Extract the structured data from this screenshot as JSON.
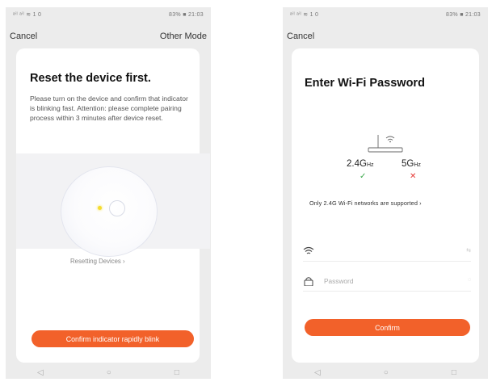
{
  "left": {
    "status_left": "ᵃⁱˡ ᵃⁱˡ ≋ 1 0",
    "status_right": "83% ■ 21:03",
    "nav_cancel": "Cancel",
    "nav_other_mode": "Other Mode",
    "title": "Reset the device first.",
    "description": "Please turn on the device and confirm that indicator is blinking fast. Attention: please complete pairing process within 3 minutes after device reset.",
    "resetting_link": "Resetting Devices",
    "resetting_chevron": "›",
    "confirm_button": "Confirm indicator rapidly blink"
  },
  "right": {
    "status_left": "ᵃⁱˡ ᵃⁱˡ ≋ 1 0",
    "status_right": "83% ■ 21:03",
    "nav_cancel": "Cancel",
    "title": "Enter Wi-Fi Password",
    "band_24": "2.4G",
    "band_24_unit": "Hz",
    "band_5": "5G",
    "band_5_unit": "Hz",
    "check_mark": "✓",
    "cross_mark": "✕",
    "note": "Only 2.4G Wi-Fi networks are supported",
    "note_chevron": "›",
    "ssid_value": "",
    "ssid_end": "⇆",
    "password_placeholder": "Password",
    "password_end": "◌",
    "confirm_button": "Confirm"
  },
  "bottom_nav": {
    "back": "◁",
    "home": "○",
    "recent": "□"
  },
  "colors": {
    "accent": "#f2612a",
    "check": "#3aa84a",
    "cross": "#e53935"
  }
}
